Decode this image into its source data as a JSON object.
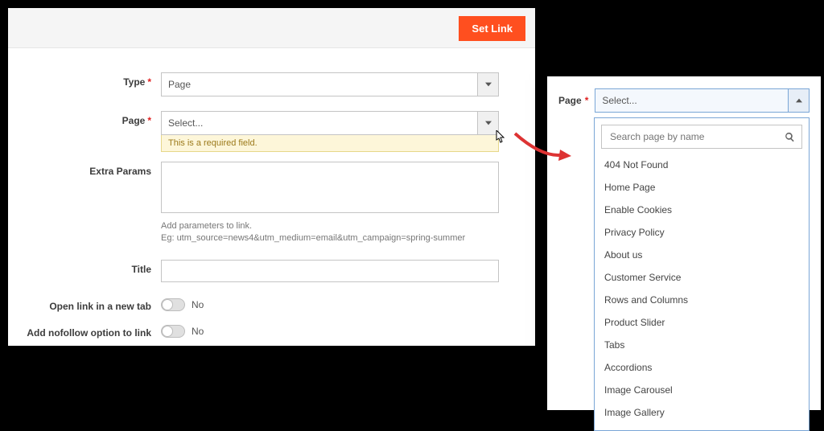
{
  "topbar": {
    "set_link": "Set Link"
  },
  "form": {
    "type": {
      "label": "Type",
      "value": "Page"
    },
    "page": {
      "label": "Page",
      "value": "Select...",
      "error": "This is a required field."
    },
    "extra": {
      "label": "Extra Params",
      "hint1": "Add parameters to link.",
      "hint2": "Eg: utm_source=news4&utm_medium=email&utm_campaign=spring-summer"
    },
    "title": {
      "label": "Title"
    },
    "newtab": {
      "label": "Open link in a new tab",
      "value": "No"
    },
    "nofollow": {
      "label": "Add nofollow option to link",
      "value": "No"
    }
  },
  "popover": {
    "label": "Page",
    "value": "Select...",
    "search_placeholder": "Search page by name",
    "options": [
      "404 Not Found",
      "Home Page",
      "Enable Cookies",
      "Privacy Policy",
      "About us",
      "Customer Service",
      "Rows and Columns",
      "Product Slider",
      "Tabs",
      "Accordions",
      "Image Carousel",
      "Image Gallery"
    ]
  }
}
